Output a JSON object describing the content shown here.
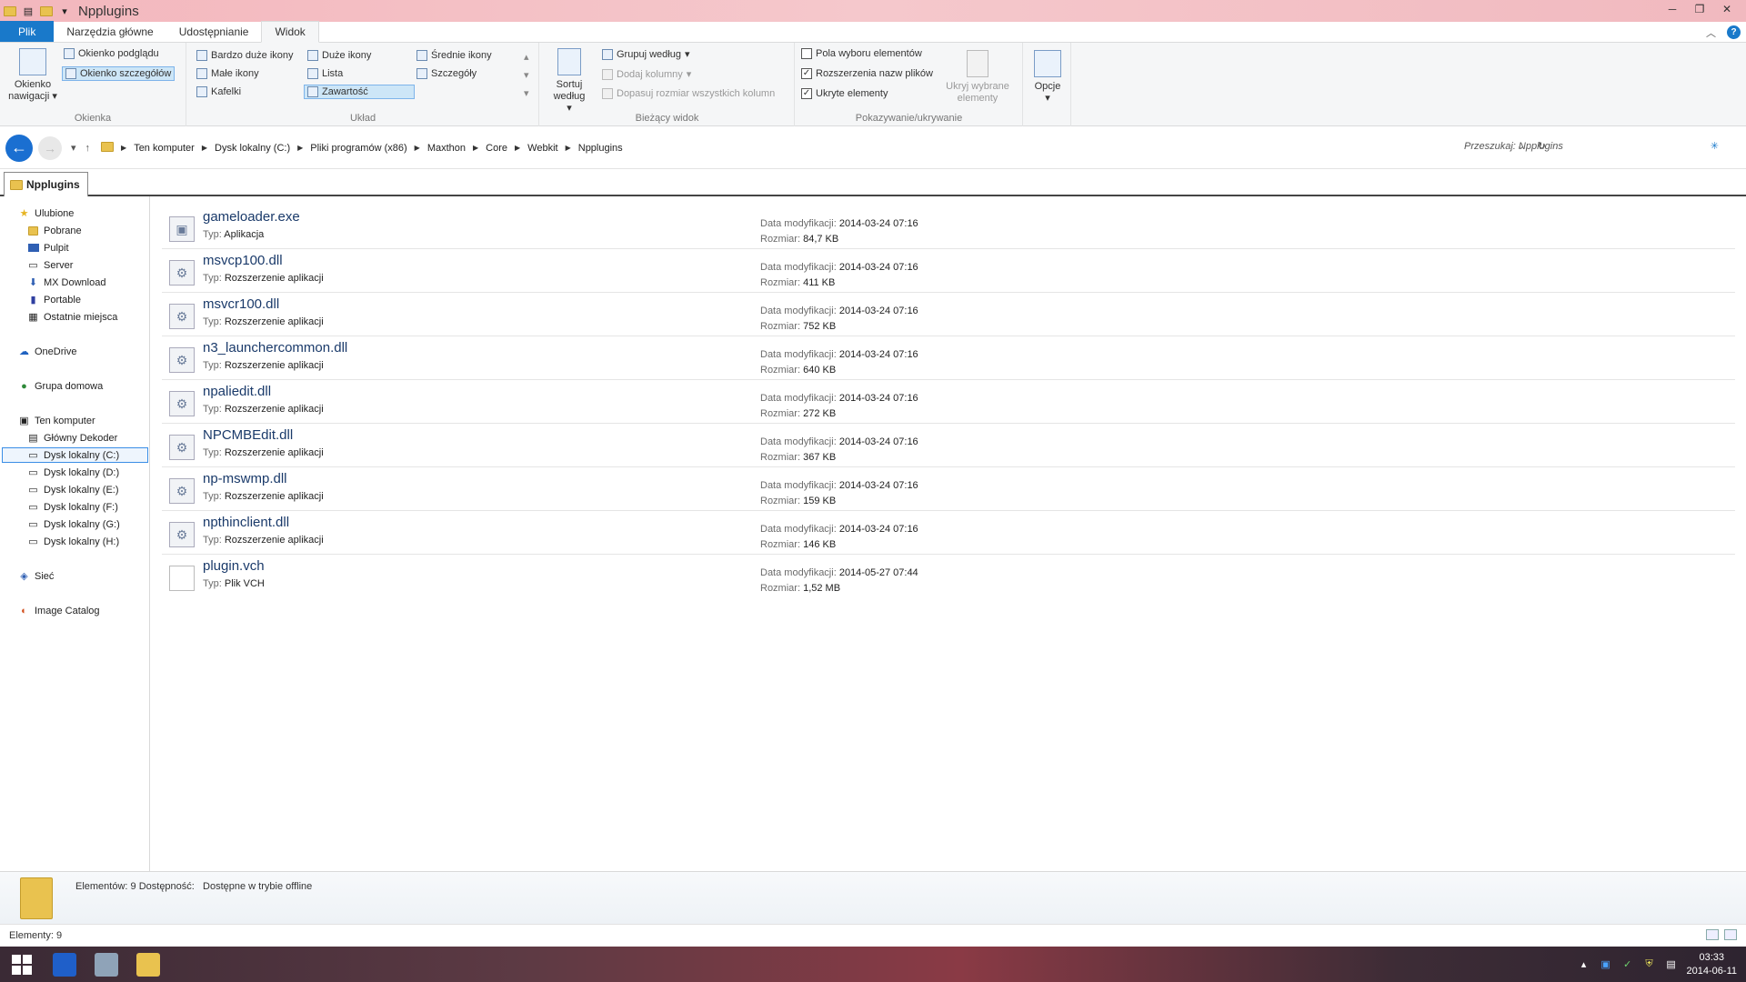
{
  "window": {
    "title": "Npplugins"
  },
  "ribbon_tabs": [
    {
      "label": "Plik"
    },
    {
      "label": "Narzędzia główne"
    },
    {
      "label": "Udostępnianie"
    },
    {
      "label": "Widok"
    }
  ],
  "ribbon": {
    "panes": {
      "label": "Okienka",
      "nav_button": "Okienko nawigacji",
      "preview": "Okienko podglądu",
      "details": "Okienko szczegółów"
    },
    "layout": {
      "label": "Układ",
      "items": [
        "Bardzo duże ikony",
        "Duże ikony",
        "Średnie ikony",
        "Małe ikony",
        "Lista",
        "Szczegóły",
        "Kafelki",
        "Zawartość"
      ]
    },
    "current_view": {
      "label": "Bieżący widok",
      "sort_button": "Sortuj według",
      "group_by": "Grupuj według",
      "add_columns": "Dodaj kolumny",
      "fit_columns": "Dopasuj rozmiar wszystkich kolumn"
    },
    "show_hide": {
      "label": "Pokazywanie/ukrywanie",
      "item_checkboxes": "Pola wyboru elementów",
      "file_extensions": "Rozszerzenia nazw plików",
      "hidden_items": "Ukryte elementy",
      "hide_selected": "Ukryj wybrane elementy",
      "checks": {
        "item_checkboxes": "",
        "file_extensions": "✓",
        "hidden_items": "✓"
      }
    },
    "options": "Opcje"
  },
  "address": {
    "crumbs": [
      "Ten komputer",
      "Dysk lokalny (C:)",
      "Pliki programów (x86)",
      "Maxthon",
      "Core",
      "Webkit",
      "Npplugins"
    ],
    "search_placeholder": "Przeszukaj: Npplugins"
  },
  "tab": {
    "label": "Npplugins"
  },
  "nav": {
    "favorites": {
      "label": "Ulubione",
      "items": [
        "Pobrane",
        "Pulpit",
        "Server",
        "MX Download",
        "Portable",
        "Ostatnie miejsca"
      ]
    },
    "onedrive": "OneDrive",
    "homegroup": "Grupa domowa",
    "this_pc": {
      "label": "Ten komputer",
      "items": [
        "Główny Dekoder",
        "Dysk lokalny (C:)",
        "Dysk lokalny (D:)",
        "Dysk lokalny (E:)",
        "Dysk lokalny (F:)",
        "Dysk lokalny (G:)",
        "Dysk lokalny (H:)"
      ]
    },
    "network": "Sieć",
    "image_catalog": "Image Catalog"
  },
  "labels": {
    "type": "Typ:",
    "modified": "Data modyfikacji:",
    "size": "Rozmiar:"
  },
  "files": [
    {
      "name": "gameloader.exe",
      "type": "Aplikacja",
      "modified": "2014-03-24 07:16",
      "size": "84,7 KB"
    },
    {
      "name": "msvcp100.dll",
      "type": "Rozszerzenie aplikacji",
      "modified": "2014-03-24 07:16",
      "size": "411 KB"
    },
    {
      "name": "msvcr100.dll",
      "type": "Rozszerzenie aplikacji",
      "modified": "2014-03-24 07:16",
      "size": "752 KB"
    },
    {
      "name": "n3_launchercommon.dll",
      "type": "Rozszerzenie aplikacji",
      "modified": "2014-03-24 07:16",
      "size": "640 KB"
    },
    {
      "name": "npaliedit.dll",
      "type": "Rozszerzenie aplikacji",
      "modified": "2014-03-24 07:16",
      "size": "272 KB"
    },
    {
      "name": "NPCMBEdit.dll",
      "type": "Rozszerzenie aplikacji",
      "modified": "2014-03-24 07:16",
      "size": "367 KB"
    },
    {
      "name": "np-mswmp.dll",
      "type": "Rozszerzenie aplikacji",
      "modified": "2014-03-24 07:16",
      "size": "159 KB"
    },
    {
      "name": "npthinclient.dll",
      "type": "Rozszerzenie aplikacji",
      "modified": "2014-03-24 07:16",
      "size": "146 KB"
    },
    {
      "name": "plugin.vch",
      "type": "Plik VCH",
      "modified": "2014-05-27 07:44",
      "size": "1,52 MB"
    }
  ],
  "details_pane": {
    "text": "Elementów: 9 Dostępność:",
    "availability": "Dostępne w trybie offline"
  },
  "status": {
    "count": "Elementy: 9"
  },
  "taskbar": {
    "time": "03:33",
    "date": "2014-06-11"
  },
  "colors": {
    "accent": "#1979ca",
    "title_bar": "#f3b7bd",
    "selection": "#cde6f7"
  }
}
